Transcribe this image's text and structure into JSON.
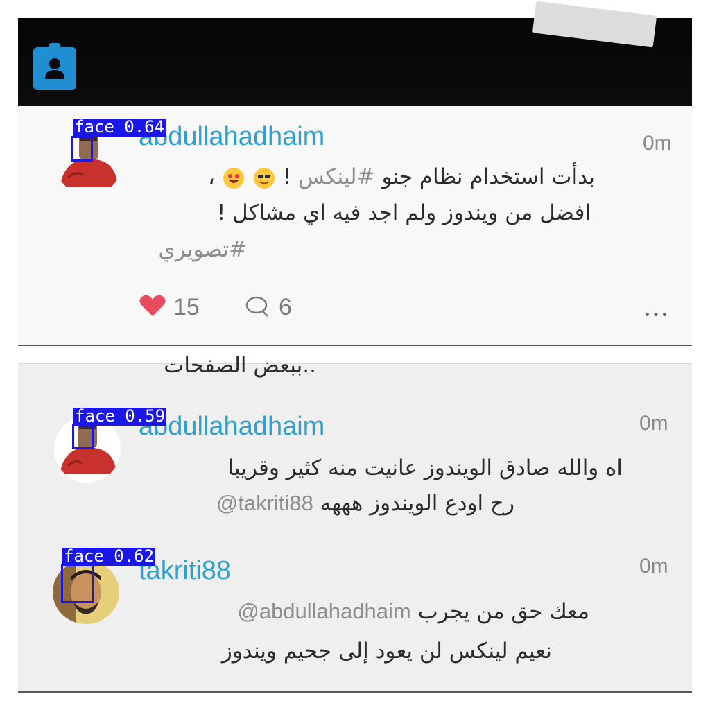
{
  "post": {
    "username": "abdullahadhaim",
    "time": "0m",
    "line1_text": "بدأت استخدام نظام جنو",
    "line1_hashtag": "#لينكس",
    "line1_tail": "!",
    "line1_punct": "،",
    "line2": "افضل من ويندوز ولم اجد فيه اي مشاكل !",
    "line3_hashtag": "#تصويري",
    "likes": "15",
    "comments": "6",
    "more": "•••"
  },
  "cut_text": "..ببعض الصفحات",
  "replies": [
    {
      "username": "abdullahadhaim",
      "time": "0m",
      "line1": "اه والله صادق الويندوز عانيت منه كثير وقريبا",
      "line2_text": "رح اودع الويندوز هههه",
      "line2_mention": "@takriti88"
    },
    {
      "username": "takriti88",
      "time": "0m",
      "line1_text": "معك حق من يجرب",
      "line1_mention": "@abdullahadhaim",
      "line2": "نعيم لينكس لن يعود إلى جحيم ويندوز"
    }
  ],
  "detections": [
    {
      "label": "face 0.64"
    },
    {
      "label": "face 0.59"
    },
    {
      "label": "face 0.62"
    }
  ],
  "colors": {
    "username": "#2f9fd0",
    "detection": "#1a17e8",
    "heart": "#e84a5f",
    "badge": "#1f8fd1"
  }
}
